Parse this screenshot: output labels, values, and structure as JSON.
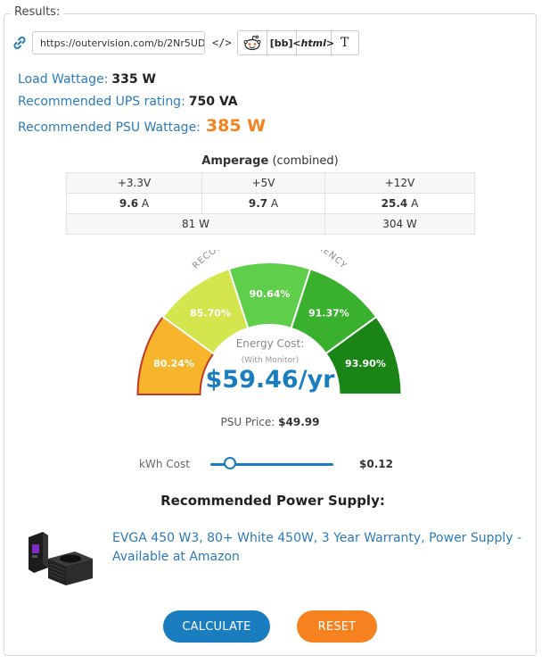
{
  "results_label": "Results:",
  "share": {
    "url": "https://outervision.com/b/2Nr5UD",
    "code_symbol": "</>",
    "buttons": [
      "",
      "[bb]",
      "<html>",
      "T"
    ],
    "icons": [
      "link-icon",
      "reddit-icon"
    ]
  },
  "summary": {
    "load_label": "Load Wattage:",
    "load_value": "335 W",
    "ups_label": "Recommended UPS rating:",
    "ups_value": "750 VA",
    "psu_label": "Recommended PSU Wattage:",
    "psu_value": "385 W"
  },
  "amperage": {
    "title_bold": "Amperage",
    "title_rest": " (combined)",
    "headers": [
      "+3.3V",
      "+5V",
      "+12V"
    ],
    "amps": [
      {
        "num": "9.6",
        "unit": " A"
      },
      {
        "num": "9.7",
        "unit": " A"
      },
      {
        "num": "25.4",
        "unit": " A"
      }
    ],
    "watts_combined": "81 W",
    "watts_12v": "304 W"
  },
  "gauge": {
    "title": "RECOMMENDED PSU EFFICIENCY",
    "segments": [
      {
        "label": "80.24%",
        "color": "#f7b52c",
        "selected": true
      },
      {
        "label": "85.70%",
        "color": "#d3e64d",
        "selected": false
      },
      {
        "label": "90.64%",
        "color": "#5fce4b",
        "selected": false
      },
      {
        "label": "91.37%",
        "color": "#39b12f",
        "selected": false
      },
      {
        "label": "93.90%",
        "color": "#1a8417",
        "selected": false
      }
    ],
    "selected_border": "#c0392b"
  },
  "energy": {
    "label": "Energy Cost:",
    "sub": "(With Monitor)",
    "value": "$59.46/yr"
  },
  "psu_price": {
    "label": "PSU Price:",
    "value": "$49.99"
  },
  "kwh": {
    "label": "kWh Cost",
    "value": "$0.12",
    "level_fraction": 0.16
  },
  "recommendation": {
    "title": "Recommended Power Supply:",
    "link_text": "EVGA 450 W3, 80+ White 450W, 3 Year Warranty, Power Supply - Available at Amazon"
  },
  "actions": {
    "calculate": "CALCULATE",
    "reset": "RESET"
  },
  "colors": {
    "accent_blue": "#1a7dc0",
    "accent_orange": "#f5821f",
    "label_blue": "#2b7bb9"
  }
}
